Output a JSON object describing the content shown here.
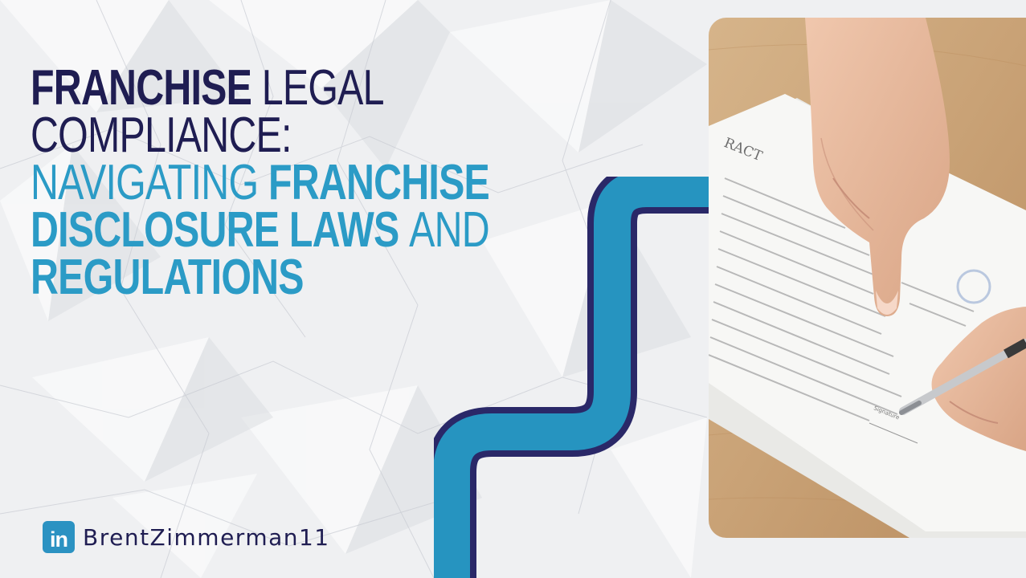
{
  "headline": {
    "line1_bold": "FRANCHISE",
    "line1_light": "LEGAL",
    "line2": "COMPLIANCE:",
    "line3_light": "NAVIGATING",
    "line3_bold": "FRANCHISE",
    "line4_bold": "DISCLOSURE LAWS",
    "line4_light": "AND",
    "line5_bold": "REGULATIONS"
  },
  "colors": {
    "navy": "#1f1d52",
    "accent_blue": "#2b9bc6",
    "background": "#f1f2f4"
  },
  "photo": {
    "document_heading": "RACT",
    "signature_label": "Signature"
  },
  "social": {
    "icon": "linkedin-icon",
    "icon_text": "in",
    "handle": "BrentZimmerman11"
  }
}
